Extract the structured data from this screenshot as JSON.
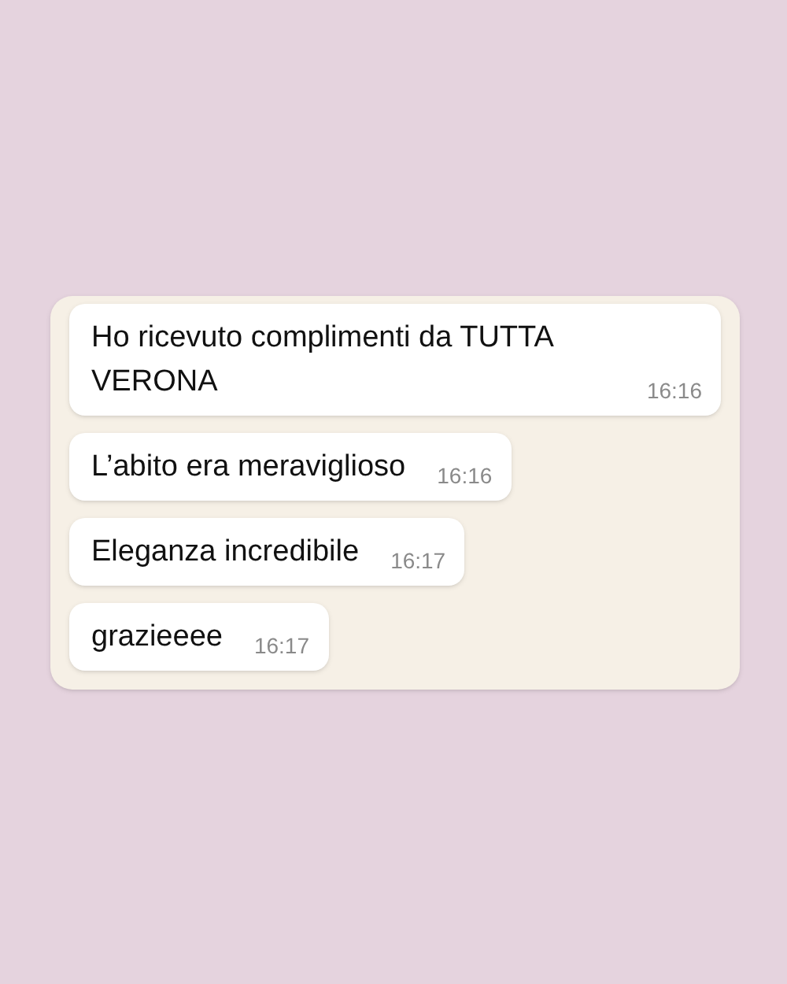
{
  "messages": [
    {
      "text": "Ho ricevuto complimenti da TUTTA VERONA",
      "time": "16:16"
    },
    {
      "text": "L’abito era meraviglioso",
      "time": "16:16"
    },
    {
      "text": "Eleganza incredibile",
      "time": "16:17"
    },
    {
      "text": "grazieeee",
      "time": "16:17"
    }
  ]
}
